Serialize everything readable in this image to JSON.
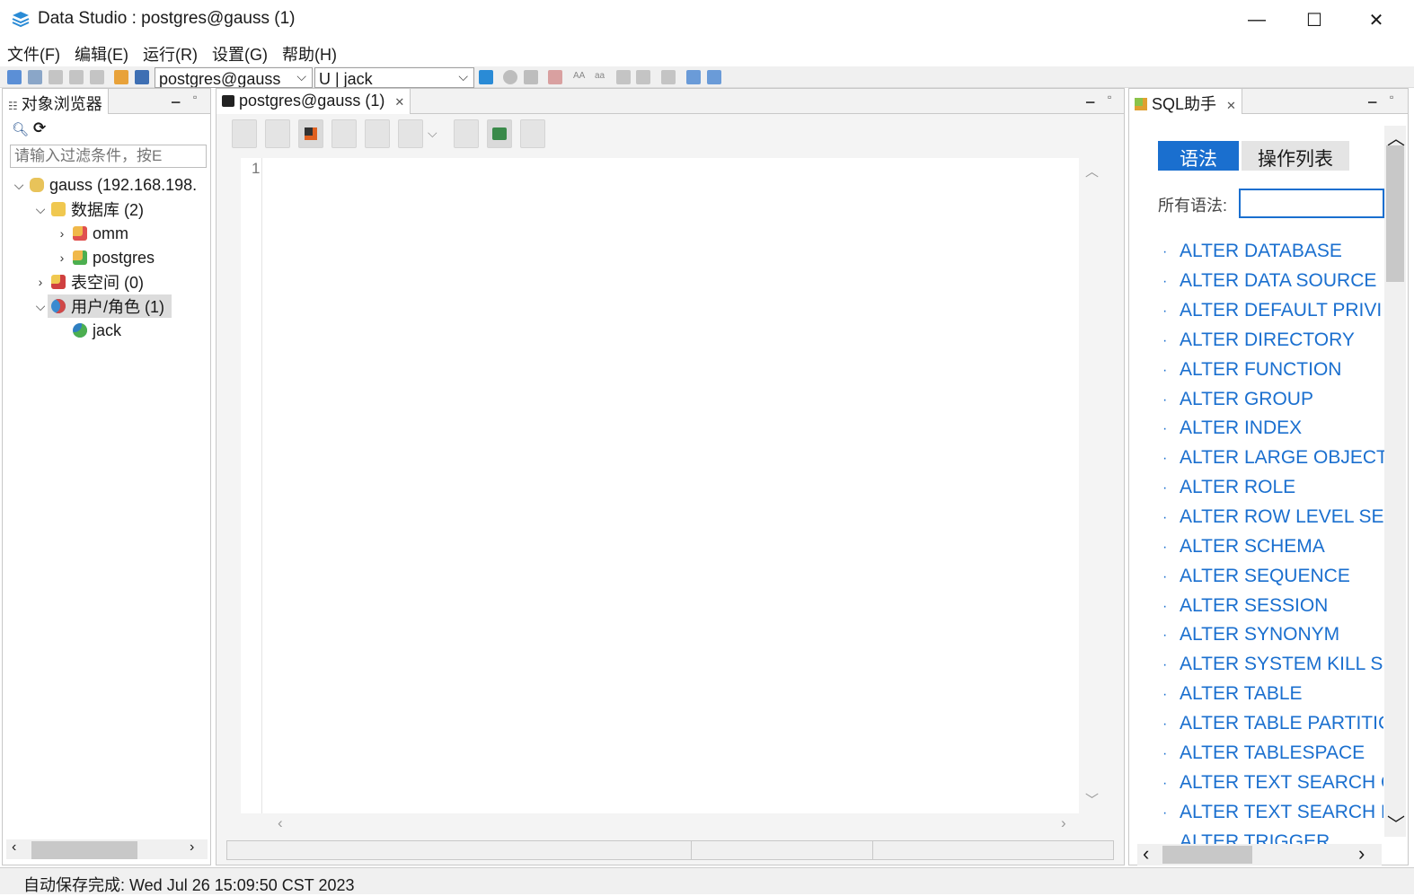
{
  "window": {
    "title": "Data Studio : postgres@gauss (1)",
    "minimize": "—",
    "maximize": "☐",
    "close": "✕"
  },
  "menu": [
    "文件(F)",
    "编辑(E)",
    "运行(R)",
    "设置(G)",
    "帮助(H)"
  ],
  "toolbar": {
    "connection_combo": "postgres@gauss",
    "user_combo": "U | jack",
    "text_icons": [
      "AA",
      "aa"
    ]
  },
  "object_browser": {
    "tab_label": "对象浏览器",
    "filter_placeholder": "请输入过滤条件，按E",
    "tree": {
      "root": "gauss (192.168.198.",
      "databases": "数据库 (2)",
      "db1": "omm",
      "db2": "postgres",
      "tablespaces": "表空间 (0)",
      "users": "用户/角色 (1)",
      "user1": "jack"
    }
  },
  "editor": {
    "tab_label": "postgres@gauss (1)",
    "line_number": "1"
  },
  "sql_helper": {
    "tab_label": "SQL助手",
    "tab_syntax": "语法",
    "tab_ops": "操作列表",
    "search_label": "所有语法:",
    "search_value": "",
    "items": [
      "ALTER DATABASE",
      "ALTER DATA SOURCE",
      "ALTER DEFAULT PRIVIL",
      "ALTER DIRECTORY",
      "ALTER FUNCTION",
      "ALTER GROUP",
      "ALTER INDEX",
      "ALTER LARGE OBJECT",
      "ALTER ROLE",
      "ALTER ROW LEVEL SEC",
      "ALTER SCHEMA",
      "ALTER SEQUENCE",
      "ALTER SESSION",
      "ALTER SYNONYM",
      "ALTER SYSTEM KILL SE",
      "ALTER TABLE",
      "ALTER TABLE PARTITIC",
      "ALTER TABLESPACE",
      "ALTER TEXT SEARCH C",
      "ALTER TEXT SEARCH D",
      "ALTER TRIGGER"
    ]
  },
  "status": {
    "text": "自动保存完成:  Wed Jul 26 15:09:50 CST 2023"
  },
  "colors": {
    "link": "#1a6fcf",
    "accent_tab": "#1a6fcf"
  }
}
